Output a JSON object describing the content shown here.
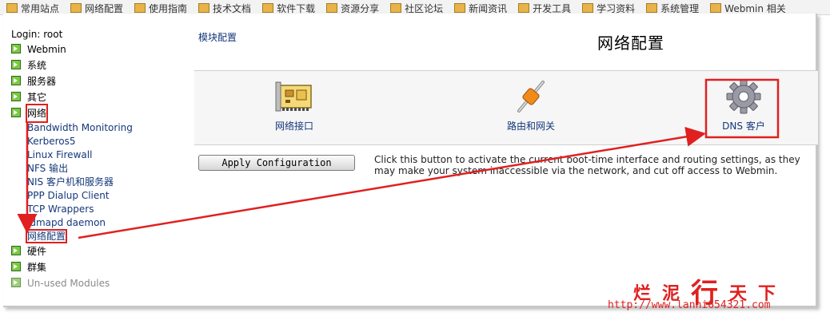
{
  "bookmarks": [
    {
      "label": "常用站点"
    },
    {
      "label": "网络配置"
    },
    {
      "label": "使用指南"
    },
    {
      "label": "技术文档"
    },
    {
      "label": "软件下载"
    },
    {
      "label": "资源分享"
    },
    {
      "label": "社区论坛"
    },
    {
      "label": "新闻资讯"
    },
    {
      "label": "开发工具"
    },
    {
      "label": "学习资料"
    },
    {
      "label": "系统管理"
    },
    {
      "label": "Webmin 相关"
    }
  ],
  "sidebar": {
    "login": "Login: root",
    "categories": [
      {
        "label": "Webmin"
      },
      {
        "label": "系统"
      },
      {
        "label": "服务器"
      },
      {
        "label": "其它"
      },
      {
        "label": "网络"
      }
    ],
    "network_items": [
      {
        "label": "Bandwidth Monitoring"
      },
      {
        "label": "Kerberos5"
      },
      {
        "label": "Linux Firewall"
      },
      {
        "label": "NFS 输出"
      },
      {
        "label": "NIS 客户机和服务器"
      },
      {
        "label": "PPP Dialup Client"
      },
      {
        "label": "TCP Wrappers"
      },
      {
        "label": "idmapd daemon"
      },
      {
        "label": "网络配置"
      }
    ],
    "after": [
      {
        "label": "硬件"
      },
      {
        "label": "群集"
      },
      {
        "label": "Un-used Modules"
      }
    ]
  },
  "main": {
    "module_config": "模块配置",
    "title": "网络配置",
    "tiles": [
      {
        "label": "网络接口",
        "icon": "network-card-icon"
      },
      {
        "label": "路由和网关",
        "icon": "gateway-icon"
      },
      {
        "label": "DNS 客户",
        "icon": "gear-icon"
      }
    ],
    "apply_button": "Apply Configuration",
    "apply_desc_line1": "Click this button to activate the current boot-time interface and routing settings, as they",
    "apply_desc_line2": "may make your system inaccessible via the network, and cut off access to Webmin."
  },
  "annotation_color": "#e02020",
  "watermark": {
    "logo_a": "烂泥",
    "logo_b": "行",
    "logo_c": "天下",
    "url": "http://www.lanni654321.com"
  }
}
